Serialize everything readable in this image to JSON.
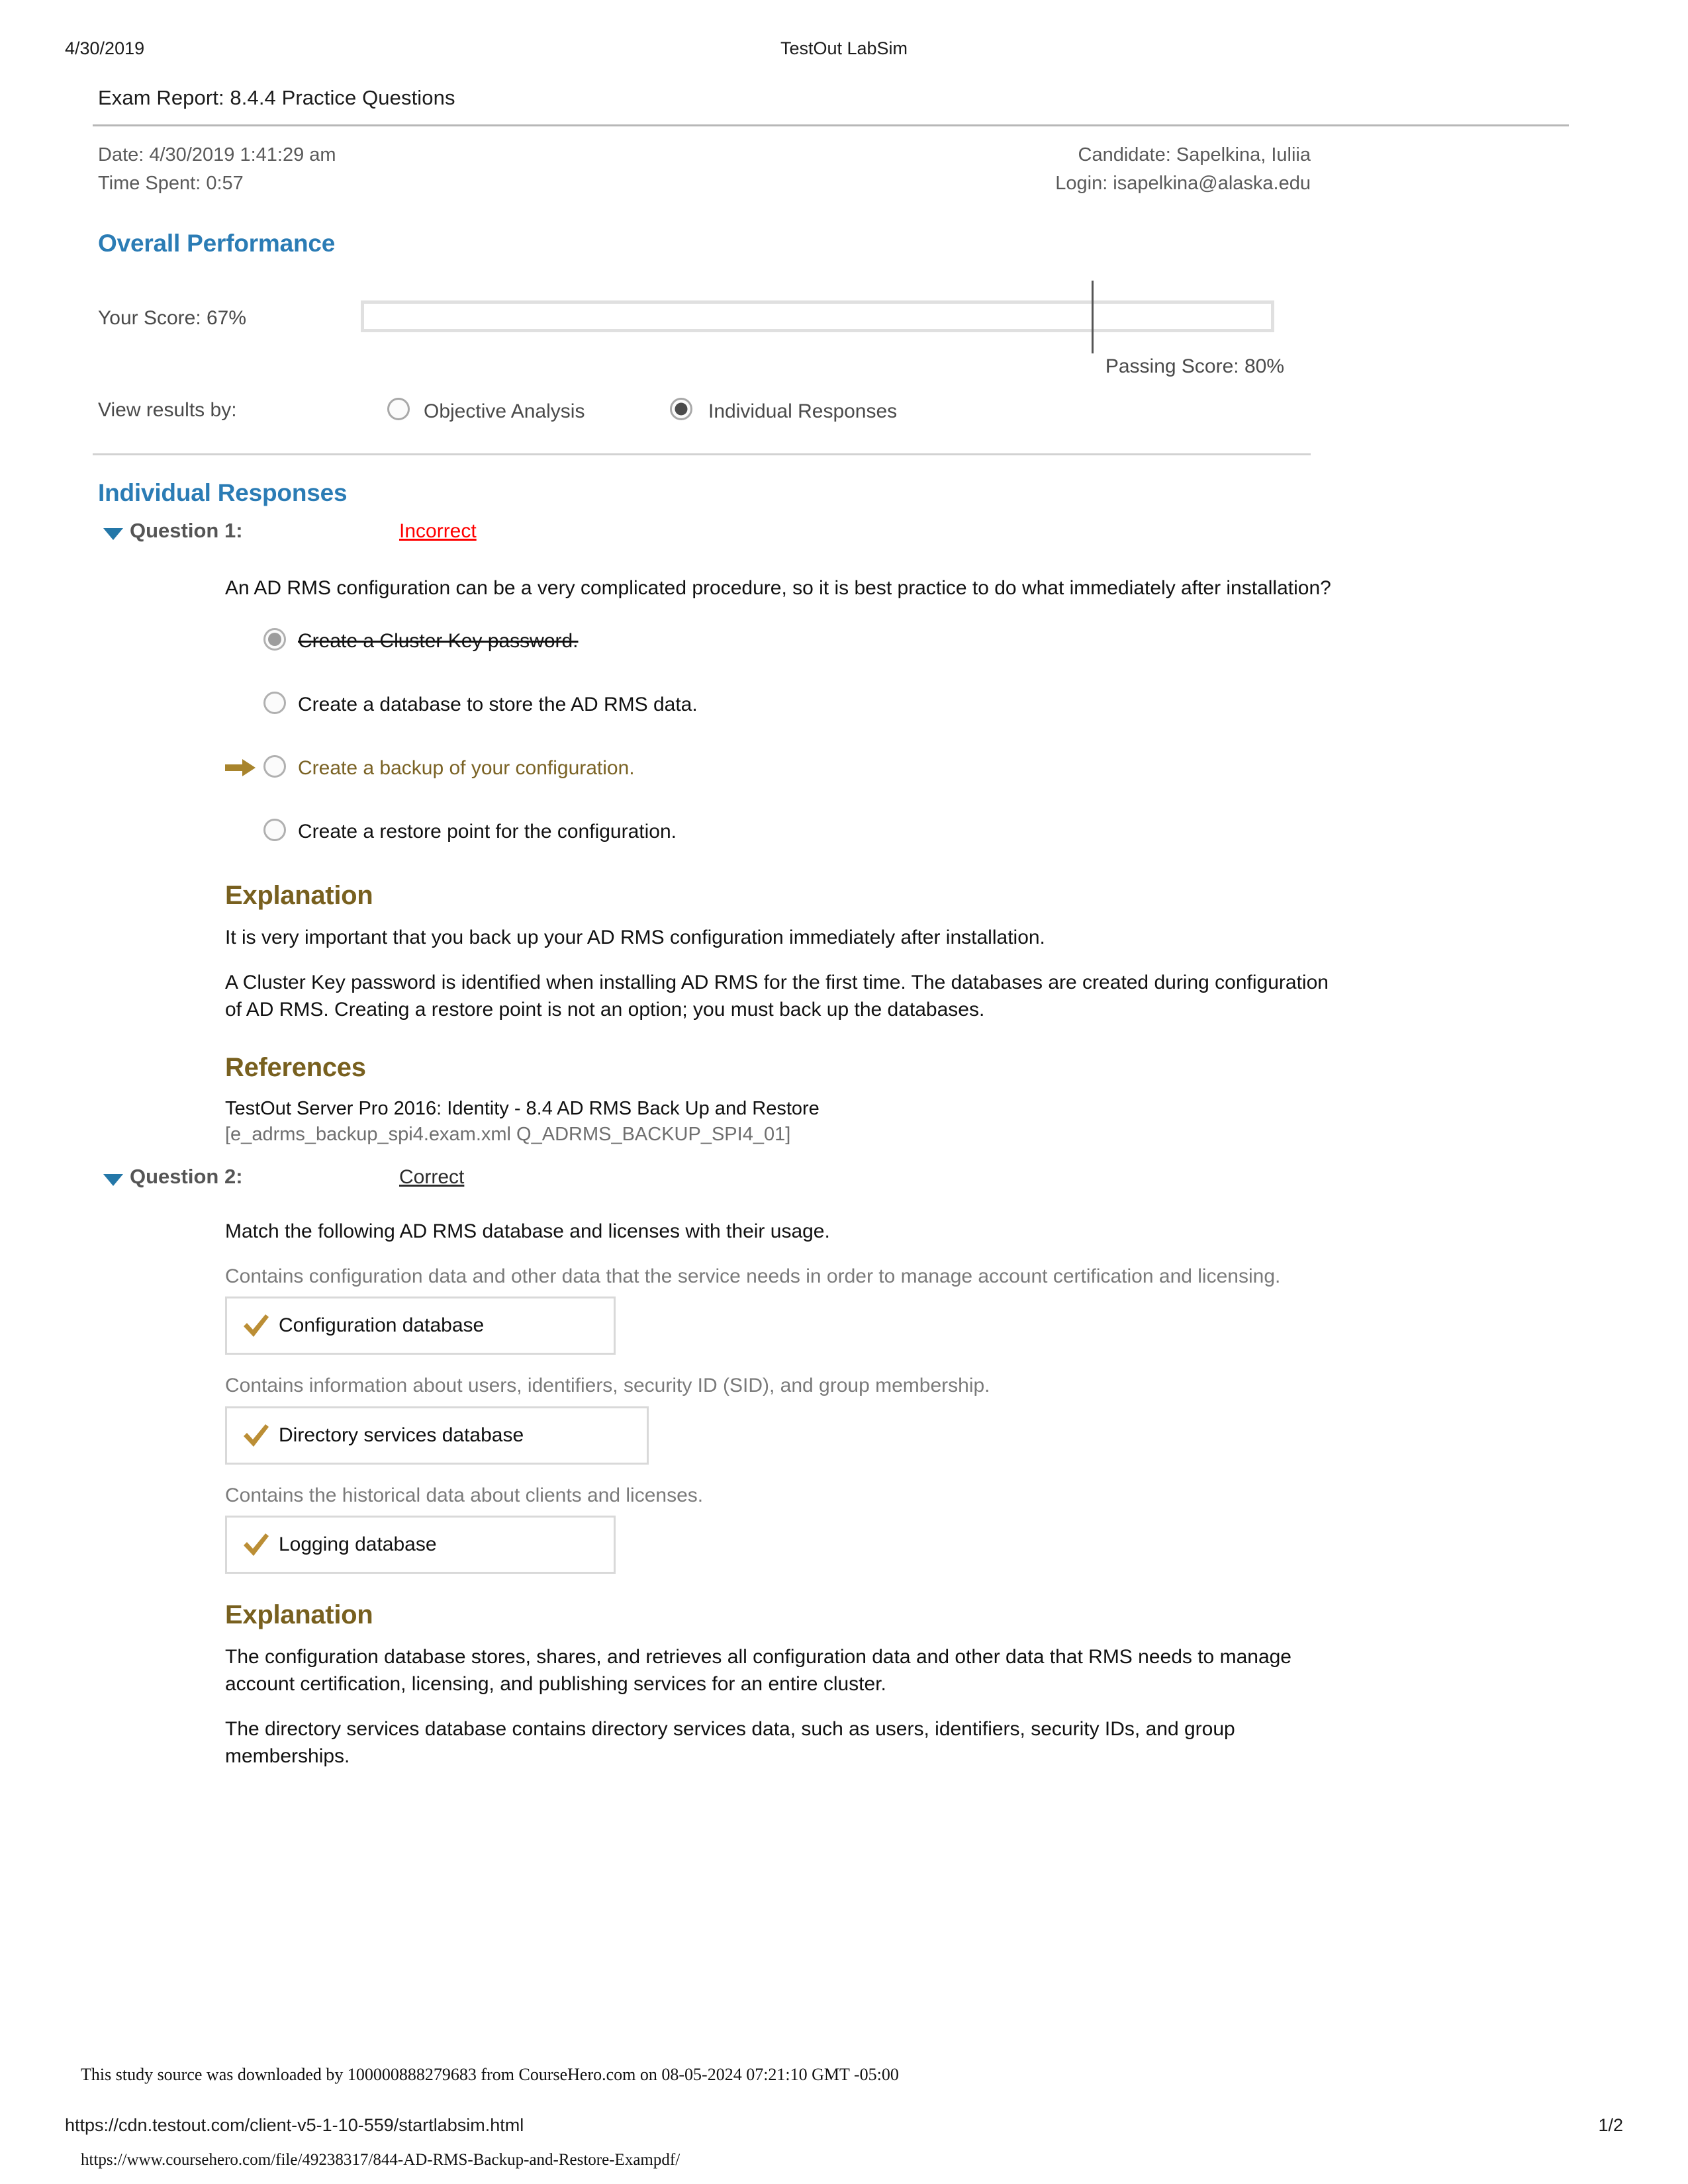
{
  "running_head": {
    "date": "4/30/2019",
    "title": "TestOut LabSim"
  },
  "report": {
    "title": "Exam Report: 8.4.4 Practice Questions",
    "date_line": "Date: 4/30/2019 1:41:29 am",
    "time_spent_line": "Time Spent: 0:57",
    "candidate_line": "Candidate: Sapelkina, Iuliia",
    "login_line": "Login: isapelkina@alaska.edu"
  },
  "overall_performance": {
    "heading": "Overall Performance",
    "your_score_label": "Your Score:  67%",
    "your_score_value": 67,
    "passing_score_label": "Passing Score:  80%",
    "passing_score_value": 80,
    "accent_color": "#2b7cb5"
  },
  "view_results": {
    "label": "View results by:",
    "options": [
      {
        "label": "Objective Analysis",
        "selected": false
      },
      {
        "label": "Individual Responses",
        "selected": true
      }
    ]
  },
  "individual_responses": {
    "heading": "Individual Responses"
  },
  "questions": [
    {
      "label": "Question 1:",
      "status": "Incorrect",
      "status_kind": "incorrect",
      "prompt": "An AD RMS configuration can be a very complicated procedure, so it is best practice to do what immediately after installation?",
      "options": [
        {
          "text": "Create a Cluster Key password.",
          "selected": true,
          "struck": true,
          "is_answer": false
        },
        {
          "text": "Create a database to store the AD RMS data.",
          "selected": false,
          "struck": false,
          "is_answer": false
        },
        {
          "text": "Create a backup of your configuration.",
          "selected": false,
          "struck": false,
          "is_answer": true
        },
        {
          "text": "Create a restore point for the configuration.",
          "selected": false,
          "struck": false,
          "is_answer": false
        }
      ],
      "explanation_heading": "Explanation",
      "explanation_paragraphs": [
        "It is very important that you back up your AD RMS configuration immediately after installation.",
        "A Cluster Key password is identified when installing AD RMS for the first time. The databases are created during configuration of AD RMS. Creating a restore point is not an option; you must back up the databases."
      ],
      "references_heading": "References",
      "reference_title": "TestOut Server Pro 2016: Identity - 8.4 AD RMS Back Up and Restore",
      "reference_id": "[e_adrms_backup_spi4.exam.xml Q_ADRMS_BACKUP_SPI4_01]"
    },
    {
      "label": "Question 2:",
      "status": "Correct",
      "status_kind": "correct",
      "prompt": "Match the following AD RMS database and licenses with their usage.",
      "matches": [
        {
          "prompt": "Contains configuration data and other data that the service needs in order to manage account certification and licensing.",
          "answer": "Configuration database"
        },
        {
          "prompt": "Contains information about users, identifiers, security ID (SID), and group membership.",
          "answer": "Directory services database"
        },
        {
          "prompt": "Contains the historical data about clients and licenses.",
          "answer": "Logging database"
        }
      ],
      "explanation_heading": "Explanation",
      "explanation_paragraphs": [
        "The configuration database stores, shares, and retrieves all configuration data and other data that RMS needs to manage account certification, licensing, and publishing services for an entire cluster.",
        "The directory services database contains directory services data, such as users, identifiers, security IDs, and group memberships."
      ]
    }
  ],
  "watermark": {
    "text": "This study source was downloaded by 100000888279683 from CourseHero.com on 08-05-2024 07:21:10 GMT -05:00"
  },
  "footer": {
    "url": "https://cdn.testout.com/client-v5-1-10-559/startlabsim.html",
    "page": "1/2",
    "coursehero_url": "https://www.coursehero.com/file/49238317/844-AD-RMS-Backup-and-Restore-Exampdf/"
  }
}
